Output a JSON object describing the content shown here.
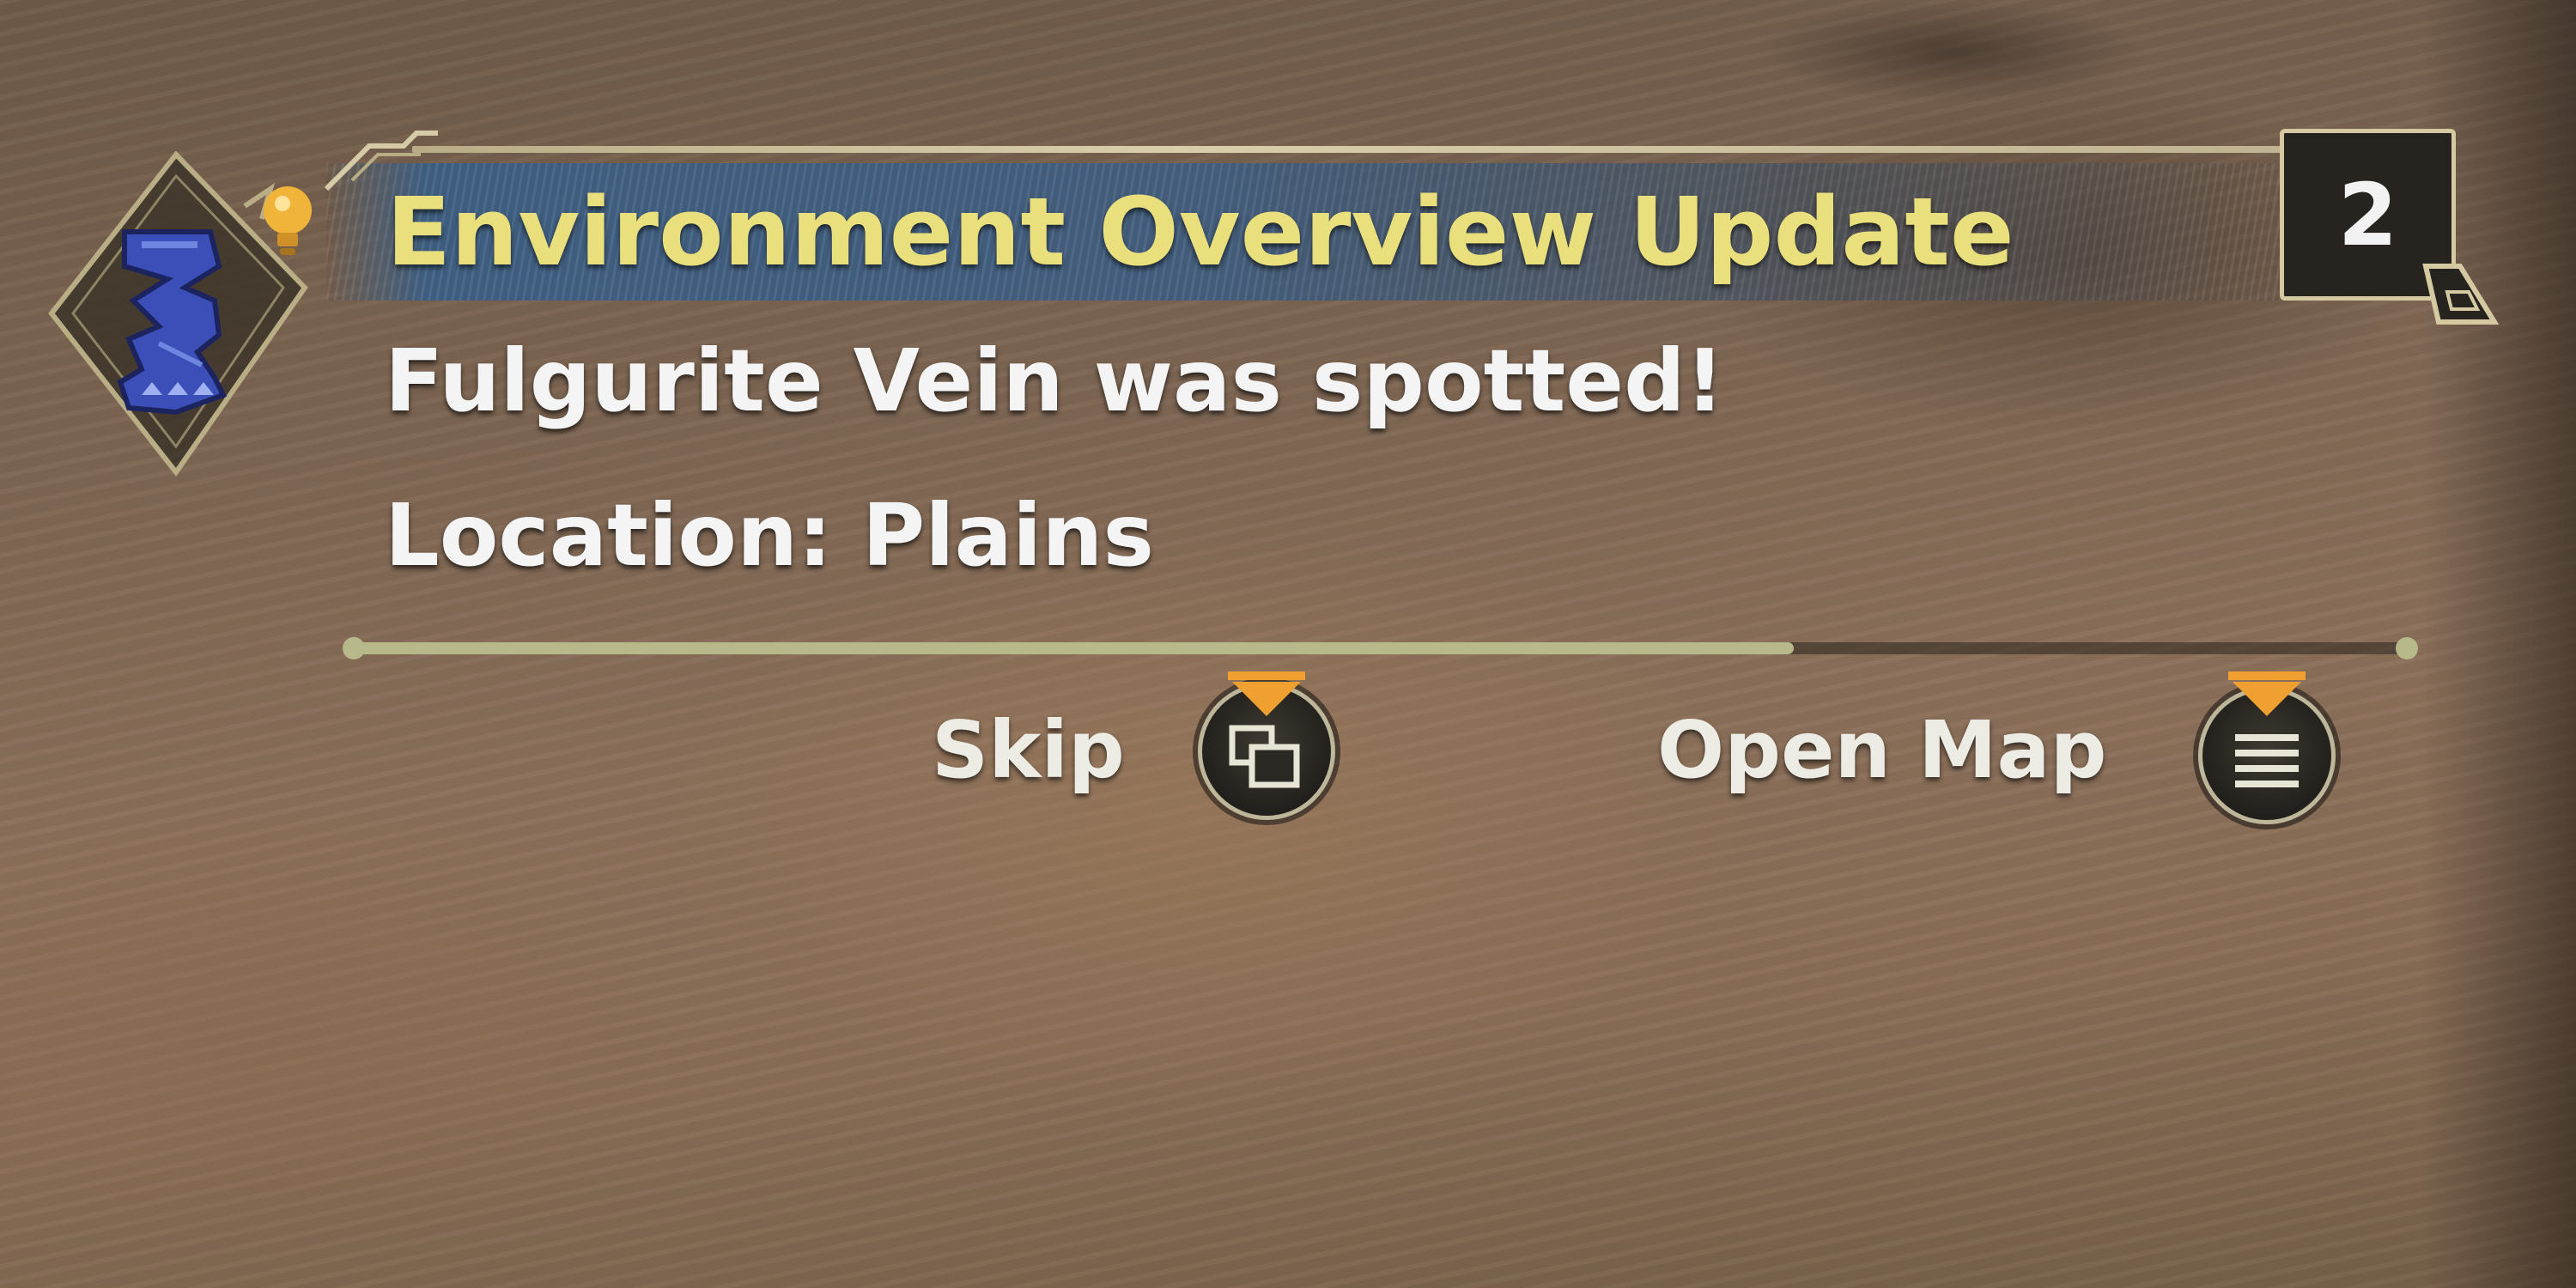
{
  "notification": {
    "title": "Environment Overview Update",
    "counter": "2",
    "message": "Fulgurite Vein was spotted!",
    "location": "Location: Plains",
    "progress_fraction": 0.7
  },
  "actions": {
    "skip_label": "Skip",
    "open_map_label": "Open Map"
  },
  "icons": {
    "emblem": "monster-hunter-emblem-icon",
    "hint": "lightbulb-icon",
    "skip_button": "view-toggle-icon",
    "map_button": "menu-lines-icon",
    "indicator": "orange-down-arrow-icon"
  },
  "colors": {
    "title": "#e9df7c",
    "banner": "#3e6288",
    "progress": "#b8b98a",
    "indicator": "#f0a030"
  }
}
